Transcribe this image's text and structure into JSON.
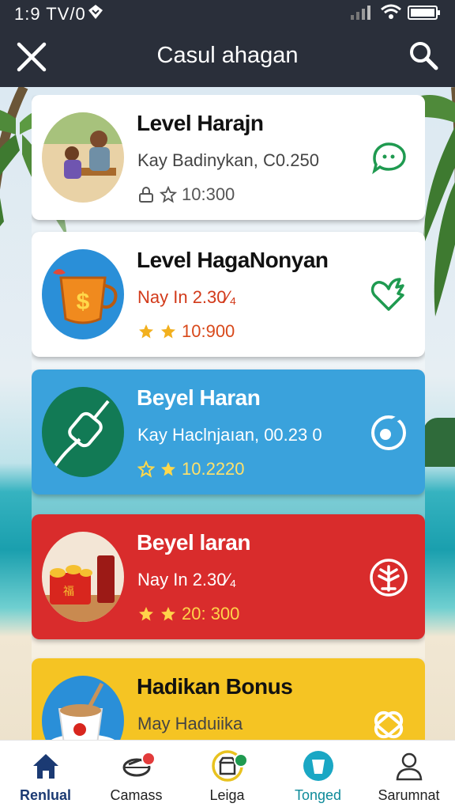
{
  "status_bar": {
    "time": "1:9 TV/0"
  },
  "header": {
    "title": "Casul ahagan"
  },
  "cards": [
    {
      "title": "Level Harajn",
      "subtitle": "Kay Badinykan, C0.250",
      "value": "10:300",
      "theme": "white"
    },
    {
      "title": "Level HagaNonyan",
      "subtitle": "Nay In 2.30⁄₄",
      "value": "10:900",
      "theme": "white"
    },
    {
      "title": "Beyel Haran",
      "subtitle": "Kay Haclnjaıan, 00.23 0",
      "value": "10.2220",
      "theme": "blue"
    },
    {
      "title": "Beyel laran",
      "subtitle": "Nay In 2.30⁄₄",
      "value": "20: 300",
      "theme": "red"
    },
    {
      "title": "Hadikan Bonus",
      "subtitle": "May Haduiika",
      "value": "",
      "theme": "yellow"
    }
  ],
  "nav": [
    {
      "label": "Renlual",
      "icon": "home-icon",
      "active": true
    },
    {
      "label": "Camass",
      "icon": "basket-icon"
    },
    {
      "label": "Leiga",
      "icon": "store-icon"
    },
    {
      "label": "Tonged",
      "icon": "cup-icon"
    },
    {
      "label": "Sarumnat",
      "icon": "person-icon"
    }
  ],
  "colors": {
    "header_bg": "#2a2f3a",
    "blue_card": "#3aa2dc",
    "red_card": "#d92c2c",
    "yellow_card": "#f5c423",
    "nav_active": "#1b3a73",
    "teal": "#0e8b9a",
    "star": "#f2b01e"
  }
}
